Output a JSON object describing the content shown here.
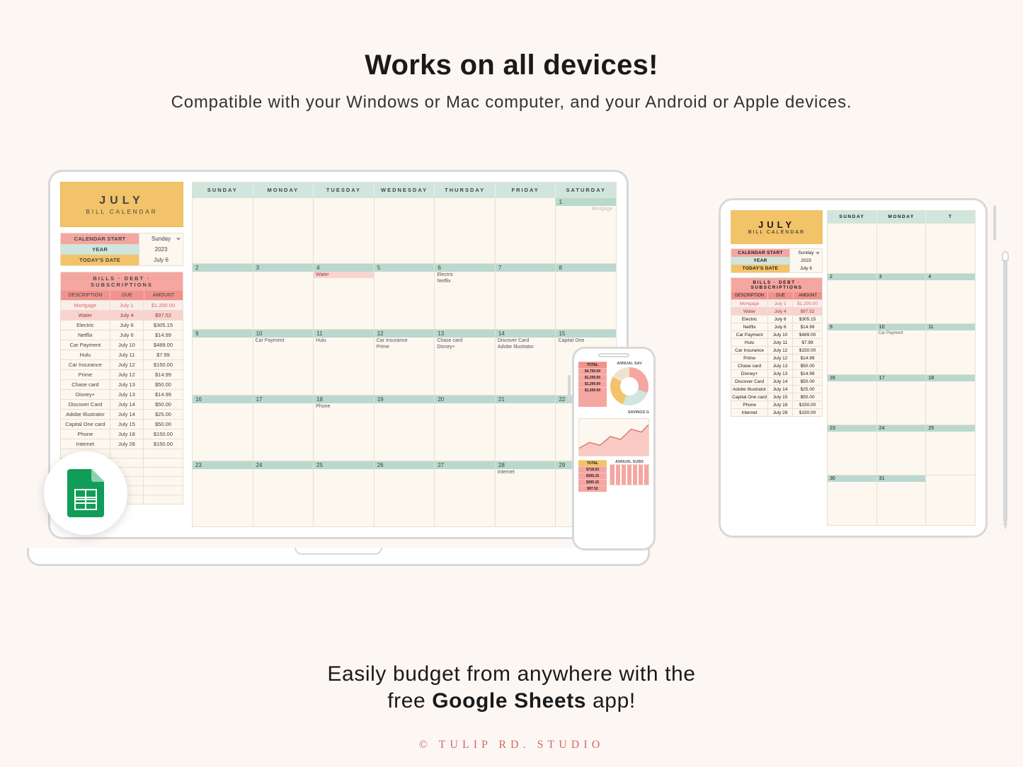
{
  "headline_title": "Works on all devices!",
  "headline_sub": "Compatible with your Windows or Mac computer, and your Android or Apple devices.",
  "footer_line1": "Easily budget from anywhere with the",
  "footer_line2_prefix": "free ",
  "footer_line2_bold": "Google Sheets",
  "footer_line2_suffix": " app!",
  "brand_text": "© TULIP RD. STUDIO",
  "sheet": {
    "month": "JULY",
    "month_sub": "BILL CALENDAR",
    "meta": {
      "calendar_start_label": "CALENDAR START",
      "calendar_start_value": "Sunday",
      "year_label": "YEAR",
      "year_value": "2023",
      "today_label": "TODAY'S DATE",
      "today_value": "July 6"
    },
    "bills_header": "BILLS · DEBT · SUBSCRIPTIONS",
    "bills_cols": {
      "a": "DESCRIPTION",
      "b": "DUE",
      "c": "AMOUNT"
    },
    "bills": [
      {
        "desc": "Mortgage",
        "due": "July 1",
        "amt": "$1,200.00",
        "style": "mtg"
      },
      {
        "desc": "Water",
        "due": "July 4",
        "amt": "$97.52",
        "style": "pd"
      },
      {
        "desc": "Electric",
        "due": "July 6",
        "amt": "$305.15"
      },
      {
        "desc": "Netflix",
        "due": "July 6",
        "amt": "$14.99"
      },
      {
        "desc": "Car Payment",
        "due": "July 10",
        "amt": "$489.00"
      },
      {
        "desc": "Hulu",
        "due": "July 11",
        "amt": "$7.99"
      },
      {
        "desc": "Car Insurance",
        "due": "July 12",
        "amt": "$150.00"
      },
      {
        "desc": "Prime",
        "due": "July 12",
        "amt": "$14.99"
      },
      {
        "desc": "Chase card",
        "due": "July 13",
        "amt": "$50.00"
      },
      {
        "desc": "Disney+",
        "due": "July 13",
        "amt": "$14.99"
      },
      {
        "desc": "Discover Card",
        "due": "July 14",
        "amt": "$50.00"
      },
      {
        "desc": "Adobe Illustrator",
        "due": "July 14",
        "amt": "$25.00"
      },
      {
        "desc": "Capital One card",
        "due": "July 15",
        "amt": "$50.00"
      },
      {
        "desc": "Phone",
        "due": "July 18",
        "amt": "$150.00"
      },
      {
        "desc": "Internet",
        "due": "July 28",
        "amt": "$150.00"
      }
    ],
    "days": [
      "SUNDAY",
      "MONDAY",
      "TUESDAY",
      "WEDNESDAY",
      "THURSDAY",
      "FRIDAY",
      "SATURDAY"
    ],
    "weeks": [
      [
        {
          "n": ""
        },
        {
          "n": ""
        },
        {
          "n": ""
        },
        {
          "n": ""
        },
        {
          "n": ""
        },
        {
          "n": ""
        },
        {
          "n": "1",
          "items": [
            {
              "t": "Mortgage",
              "cls": "mute"
            }
          ]
        }
      ],
      [
        {
          "n": "2"
        },
        {
          "n": "3"
        },
        {
          "n": "4",
          "items": [
            {
              "t": "Water",
              "cls": "hl"
            }
          ]
        },
        {
          "n": "5"
        },
        {
          "n": "6",
          "items": [
            {
              "t": "Electric"
            },
            {
              "t": "Netflix"
            }
          ]
        },
        {
          "n": "7"
        },
        {
          "n": "8"
        }
      ],
      [
        {
          "n": "9"
        },
        {
          "n": "10",
          "items": [
            {
              "t": "Car Payment"
            }
          ]
        },
        {
          "n": "11",
          "items": [
            {
              "t": "Hulu"
            }
          ]
        },
        {
          "n": "12",
          "items": [
            {
              "t": "Car Insurance"
            },
            {
              "t": "Prime"
            }
          ]
        },
        {
          "n": "13",
          "items": [
            {
              "t": "Chase card"
            },
            {
              "t": "Disney+"
            }
          ]
        },
        {
          "n": "14",
          "items": [
            {
              "t": "Discover Card"
            },
            {
              "t": "Adobe Illustrator"
            }
          ]
        },
        {
          "n": "15",
          "items": [
            {
              "t": "Capital One"
            }
          ]
        }
      ],
      [
        {
          "n": "16"
        },
        {
          "n": "17"
        },
        {
          "n": "18",
          "items": [
            {
              "t": "Phone"
            }
          ]
        },
        {
          "n": "19"
        },
        {
          "n": "20"
        },
        {
          "n": "21"
        },
        {
          "n": "22"
        }
      ],
      [
        {
          "n": "23"
        },
        {
          "n": "24"
        },
        {
          "n": "25"
        },
        {
          "n": "26"
        },
        {
          "n": "27"
        },
        {
          "n": "28",
          "items": [
            {
              "t": "Internet"
            }
          ]
        },
        {
          "n": "29"
        }
      ]
    ]
  },
  "tablet_days": [
    "SUNDAY",
    "MONDAY",
    "T"
  ],
  "tablet_weeks": [
    [
      {
        "n": ""
      },
      {
        "n": ""
      },
      {
        "n": ""
      }
    ],
    [
      {
        "n": "2"
      },
      {
        "n": "3"
      },
      {
        "n": "4"
      }
    ],
    [
      {
        "n": "9"
      },
      {
        "n": "10",
        "items": [
          {
            "t": "Car Payment"
          }
        ]
      },
      {
        "n": "11"
      }
    ],
    [
      {
        "n": "16"
      },
      {
        "n": "17"
      },
      {
        "n": "18"
      }
    ],
    [
      {
        "n": "23"
      },
      {
        "n": "24"
      },
      {
        "n": "25"
      }
    ],
    [
      {
        "n": "30"
      },
      {
        "n": "31"
      },
      {
        "n": ""
      }
    ]
  ],
  "phone": {
    "title1": "ANNUAL SAV",
    "title2": "SAVINGS G",
    "title3": "ANNUAL SUBS",
    "tot_labels": [
      "TOTAL",
      "$4,750.00",
      "$1,200.00",
      "$1,200.00",
      "$1,200.00"
    ],
    "tot2_labels": [
      "TOTAL",
      "$718.53",
      "$305.15",
      "$305.15",
      "$97.52"
    ]
  }
}
